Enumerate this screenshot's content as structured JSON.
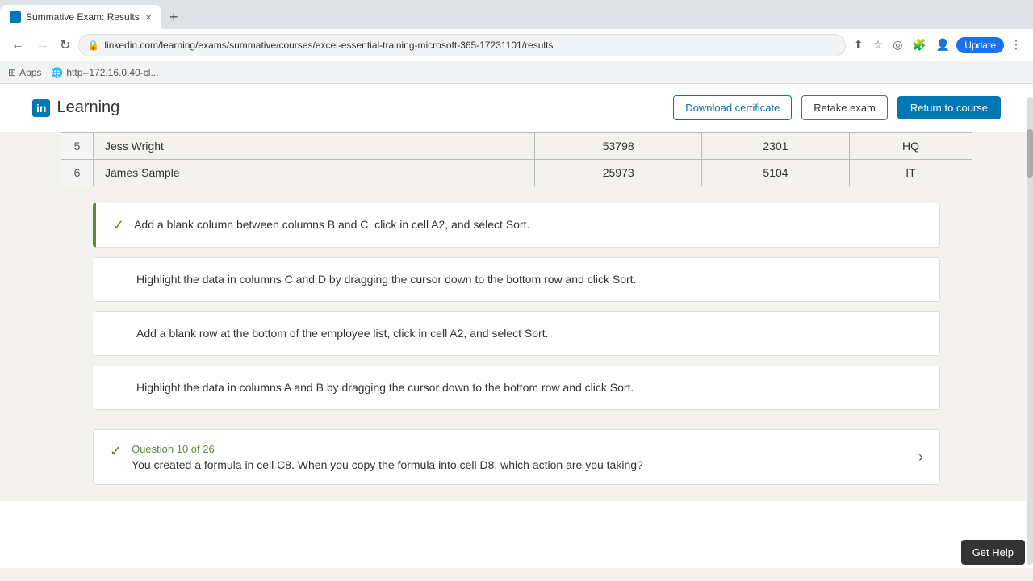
{
  "browser": {
    "tab_title": "Summative Exam: Results",
    "url": "linkedin.com/learning/exams/summative/courses/excel-essential-training-microsoft-365-17231101/results",
    "bookmarks": [
      "Apps",
      "http--172.16.0.40-cl..."
    ],
    "new_tab_label": "+",
    "nav": {
      "back": "←",
      "forward": "→",
      "refresh": "↺",
      "update_label": "Update"
    }
  },
  "header": {
    "logo_icon": "in",
    "logo_text": "Learning",
    "download_cert_label": "Download certificate",
    "retake_exam_label": "Retake exam",
    "return_course_label": "Return to course"
  },
  "table": {
    "rows": [
      {
        "num": "5",
        "name": "Jess Wright",
        "col1": "53798",
        "col2": "2301",
        "col3": "HQ"
      },
      {
        "num": "6",
        "name": "James Sample",
        "col1": "25973",
        "col2": "5104",
        "col3": "IT"
      }
    ]
  },
  "answers": [
    {
      "id": "a1",
      "correct": true,
      "text": "Add a blank column between columns B and C, click in cell A2, and select Sort."
    },
    {
      "id": "a2",
      "correct": false,
      "text": "Highlight the data in columns C and D by dragging the cursor down to the bottom row and click Sort."
    },
    {
      "id": "a3",
      "correct": false,
      "text": "Add a blank row at the bottom of the employee list, click in cell A2, and select Sort."
    },
    {
      "id": "a4",
      "correct": false,
      "text": "Highlight the data in columns A and B by dragging the cursor down to the bottom row and click Sort."
    }
  ],
  "q10": {
    "label": "Question 10 of 26",
    "text": "You created a formula in cell C8. When you copy the formula into cell D8, which action are you taking?"
  },
  "get_help": "Get Help"
}
